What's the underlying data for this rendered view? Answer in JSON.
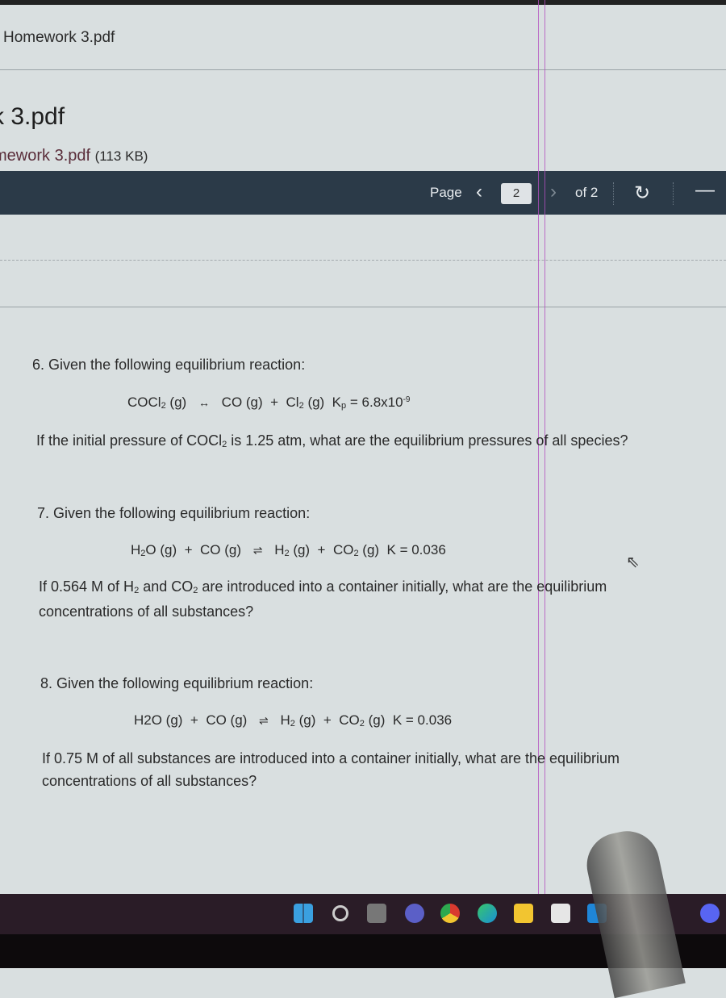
{
  "breadcrumb": {
    "title": "Homework 3.pdf"
  },
  "file": {
    "heading": "k 3.pdf",
    "link_name": "mework 3.pdf",
    "size": "(113 KB)"
  },
  "viewer_toolbar": {
    "page_label": "Page",
    "prev_icon": "‹",
    "current_page": "2",
    "next_icon": "›",
    "total_label": "of 2",
    "refresh_icon": "↻",
    "zoom_out_icon": "—"
  },
  "questions": [
    {
      "number": "6.",
      "intro": "Given the following equilibrium reaction:",
      "equation": {
        "reactant": "COCl",
        "reactant_sub": "2",
        "reactant_state": "(g)",
        "arrow": "↔",
        "product1": "CO (g)",
        "plus": "+",
        "product2": "Cl",
        "product2_sub": "2",
        "product2_state": "(g)",
        "k_label": "K",
        "k_sub": "p",
        "k_value": "= 6.8x10",
        "k_exp": "-9"
      },
      "prompt_a": "If the initial pressure of COCl",
      "prompt_sub": "2",
      "prompt_b": " is 1.25 atm, what are the equilibrium pressures of all species?"
    },
    {
      "number": "7.",
      "intro": "Given the following equilibrium reaction:",
      "equation": {
        "r1": "H",
        "r1_sub": "2",
        "r1_rest": "O (g)",
        "plus": "+",
        "r2": "CO (g)",
        "arrow": "⇌",
        "p1": "H",
        "p1_sub": "2",
        "p1_rest": " (g)",
        "p2": "CO",
        "p2_sub": "2",
        "p2_rest": " (g)",
        "k": "K = 0.036"
      },
      "prompt_line1_a": "If 0.564 M of H",
      "prompt_line1_sub1": "2",
      "prompt_line1_b": " and CO",
      "prompt_line1_sub2": "2",
      "prompt_line1_c": " are introduced into a container initially, what are the equilibrium",
      "prompt_line2": "concentrations of all substances?"
    },
    {
      "number": "8.",
      "intro": "Given the following equilibrium reaction:",
      "equation": {
        "r1": "H2O (g)",
        "plus": "+",
        "r2": "CO (g)",
        "arrow": "⇌",
        "p1": "H",
        "p1_sub": "2",
        "p1_rest": " (g)",
        "p2": "CO",
        "p2_sub": "2",
        "p2_rest": " (g)",
        "k": "K = 0.036"
      },
      "prompt_line1": "If 0.75 M of all substances are introduced into a container initially, what are the equilibrium",
      "prompt_line2": "concentrations of all substances?"
    }
  ],
  "taskbar": {
    "icons": [
      "windows-start-icon",
      "search-icon",
      "task-view-icon",
      "teams-meet-icon",
      "chrome-icon",
      "edge-icon",
      "file-explorer-icon",
      "store-icon",
      "mail-icon",
      "discord-icon"
    ],
    "colors": {
      "windows": "#3aa0e0",
      "chrome_red": "#d93a2f",
      "edge": "#1a8fd6",
      "explorer": "#f2c530",
      "mail": "#1f86d8",
      "discord": "#5865f2"
    }
  }
}
